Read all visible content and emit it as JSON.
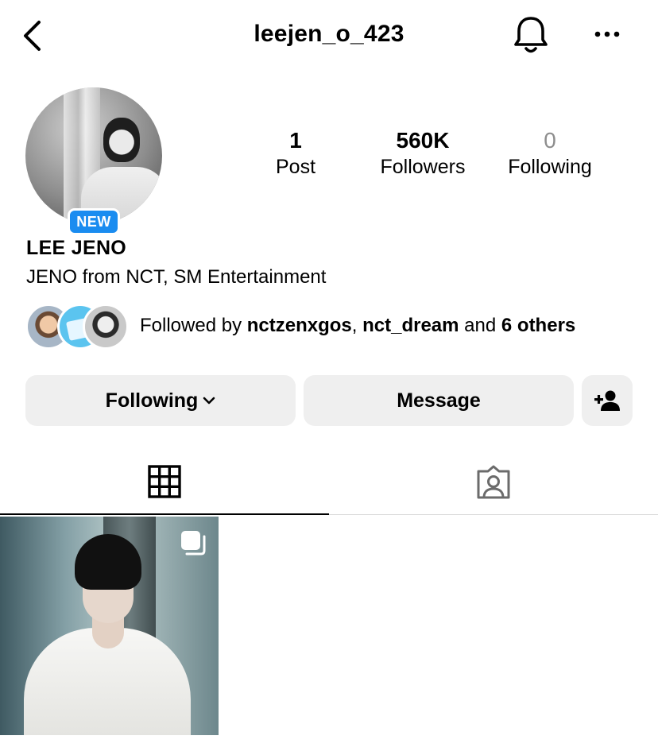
{
  "header": {
    "username": "leejen_o_423",
    "back_icon": "chevron-left-icon",
    "bell_icon": "bell-icon",
    "more_icon": "more-dots-icon"
  },
  "profile": {
    "badge": "NEW",
    "display_name": "LEE JENO",
    "bio": "JENO from NCT, SM Entertainment"
  },
  "stats": {
    "posts": {
      "value": "1",
      "label": "Post"
    },
    "followers": {
      "value": "560K",
      "label": "Followers"
    },
    "following": {
      "value": "0",
      "label": "Following"
    }
  },
  "followed_by": {
    "prefix": "Followed by ",
    "user1": "nctzenxgos",
    "sep": ", ",
    "user2": "nct_dream",
    "and": " and ",
    "others": "6 others"
  },
  "actions": {
    "following_label": "Following",
    "message_label": "Message",
    "add_user_icon": "add-user-icon"
  },
  "tabs": {
    "grid_icon": "grid-icon",
    "tagged_icon": "tagged-icon",
    "active": "grid"
  },
  "colors": {
    "badge_blue": "#1a8cf0",
    "button_gray": "#efefef",
    "muted_gray": "#8e8e8e"
  }
}
